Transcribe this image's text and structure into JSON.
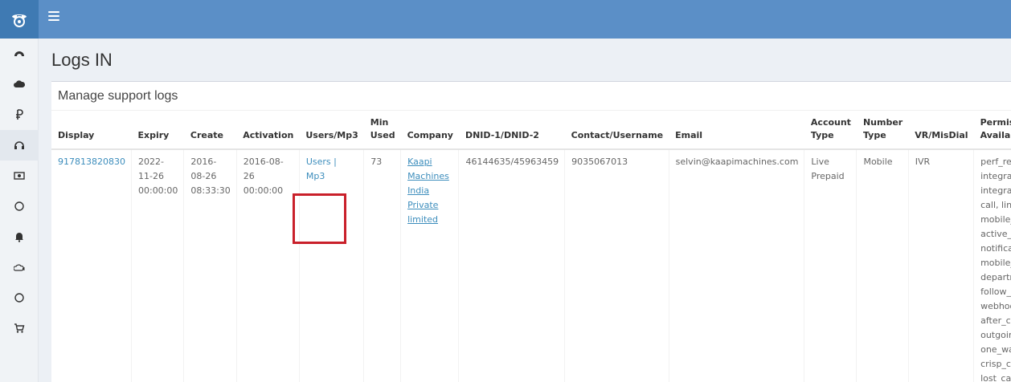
{
  "page": {
    "title": "Logs IN",
    "box_title": "Manage support logs"
  },
  "table": {
    "headers": [
      "Display",
      "Expiry",
      "Create",
      "Activation",
      "Users/Mp3",
      "Min Used",
      "Company",
      "DNID-1/DNID-2",
      "Contact/Username",
      "Email",
      "Account Type",
      "Number Type",
      "VR/MisDial",
      "Permission Available(service)"
    ],
    "row": {
      "display": "917813820830",
      "expiry": "2022-11-26 00:00:00",
      "create": "2016-08-26 08:33:30",
      "activation": "2016-08-26 00:00:00",
      "users_mp3": "Users | Mp3",
      "min_used": "73",
      "company": "Kaapi Machines India Private limited",
      "dnid": "46144635/45963459",
      "contact": "9035067013",
      "email": "selvin@kaapimachines.com",
      "account_type": "Live Prepaid",
      "number_type": "Mobile",
      "vr_misdial": "IVR",
      "permissions": "perf_report, integration_basic, integration_advance, call, lines, extension, mobile_sync, active_users, notification_sms, mobile_recording, departments, follow_up, webhook_aftercall, after_call_sms_custo outgoing_v2, fix_did, one_way_call, crisp_chat, lost_calls,"
    }
  },
  "sidebar": {
    "icons": [
      "dashboard-icon",
      "cloud-icon",
      "ruble-icon",
      "headphones-icon",
      "money-icon",
      "circle-icon",
      "bell-icon",
      "cloud-signal-icon",
      "circle-icon",
      "cart-icon"
    ]
  },
  "colors": {
    "topbar": "#5b8fc7",
    "logo_bg": "#3f7ab3",
    "link": "#3c8dbc",
    "highlight": "#c9202a"
  }
}
